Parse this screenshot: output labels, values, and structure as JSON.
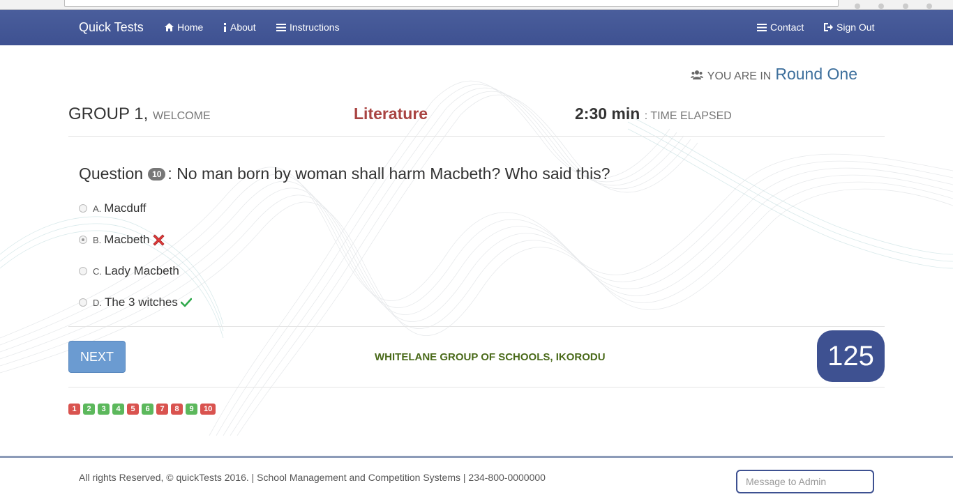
{
  "navbar": {
    "brand": "Quick Tests",
    "home": "Home",
    "about": "About",
    "instructions": "Instructions",
    "contact": "Contact",
    "signout": "Sign Out"
  },
  "round": {
    "label": "YOU ARE IN",
    "value": "Round One"
  },
  "header": {
    "group": "GROUP 1,",
    "welcome": "WELCOME",
    "subject": "Literature",
    "time": "2:30 min",
    "time_label": ": TIME ELAPSED"
  },
  "question": {
    "prefix": "Question",
    "number": "10",
    "text": ": No man born by woman shall harm Macbeth? Who said this?"
  },
  "options": [
    {
      "letter": "A.",
      "text": "Macduff",
      "selected": false,
      "mark": ""
    },
    {
      "letter": "B.",
      "text": "Macbeth",
      "selected": true,
      "mark": "wrong-icon"
    },
    {
      "letter": "C.",
      "text": "Lady Macbeth",
      "selected": false,
      "mark": ""
    },
    {
      "letter": "D.",
      "text": "The 3 witches",
      "selected": false,
      "mark": "check-icon"
    }
  ],
  "next_label": "NEXT",
  "school": "WHITELANE GROUP OF SCHOOLS, IKORODU",
  "score": "125",
  "pager": [
    {
      "n": "1",
      "status": "red"
    },
    {
      "n": "2",
      "status": "green"
    },
    {
      "n": "3",
      "status": "green"
    },
    {
      "n": "4",
      "status": "green"
    },
    {
      "n": "5",
      "status": "red"
    },
    {
      "n": "6",
      "status": "green"
    },
    {
      "n": "7",
      "status": "red"
    },
    {
      "n": "8",
      "status": "red"
    },
    {
      "n": "9",
      "status": "green"
    },
    {
      "n": "10",
      "status": "red"
    }
  ],
  "footer": {
    "text": "All rights Reserved, © quickTests 2016. | School Management and Competition Systems | 234-800-0000000",
    "message_placeholder": "Message to Admin"
  },
  "colors": {
    "navbar": "#3e5191",
    "subject": "#a94442",
    "round": "#3d6f9c",
    "school": "#4a6a1a",
    "pager_red": "#d9534f",
    "pager_green": "#5cb85c"
  }
}
